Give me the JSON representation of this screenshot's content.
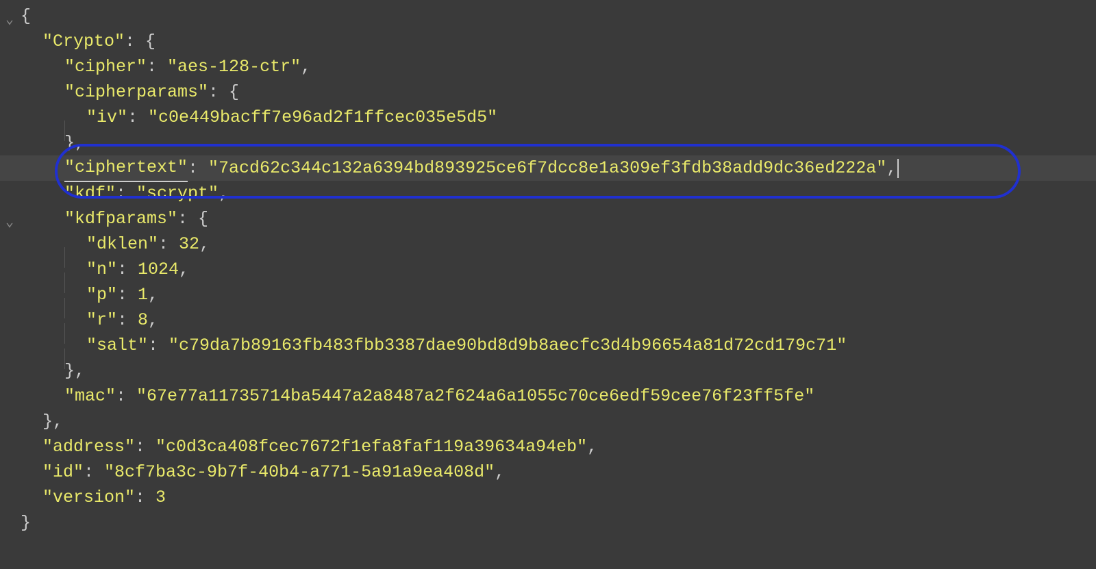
{
  "json_content": {
    "Crypto": {
      "cipher": "aes-128-ctr",
      "cipherparams": {
        "iv": "c0e449bacff7e96ad2f1ffcec035e5d5"
      },
      "ciphertext": "7acd62c344c132a6394bd893925ce6f7dcc8e1a309ef3fdb38add9dc36ed222a",
      "kdf": "scrypt",
      "kdfparams": {
        "dklen": 32,
        "n": 1024,
        "p": 1,
        "r": 8,
        "salt": "c79da7b89163fb483fbb3387dae90bd8d9b8aecfc3d4b96654a81d72cd179c71"
      },
      "mac": "67e77a11735714ba5447a2a8487a2f624a6a1055c70ce6edf59cee76f23ff5fe"
    },
    "address": "c0d3ca408fcec7672f1efa8faf119a39634a94eb",
    "id": "8cf7ba3c-9b7f-40b4-a771-5a91a9ea408d",
    "version": 3
  },
  "lines": [
    {
      "indent": 0,
      "tokens": [
        {
          "t": "punc",
          "v": "{"
        }
      ],
      "fold": true
    },
    {
      "indent": 1,
      "tokens": [
        {
          "t": "key",
          "v": "\"Crypto\""
        },
        {
          "t": "punc",
          "v": ": {"
        }
      ]
    },
    {
      "indent": 2,
      "tokens": [
        {
          "t": "key",
          "v": "\"cipher\""
        },
        {
          "t": "punc",
          "v": ": "
        },
        {
          "t": "str",
          "v": "\"aes-128-ctr\""
        },
        {
          "t": "punc",
          "v": ","
        }
      ]
    },
    {
      "indent": 2,
      "tokens": [
        {
          "t": "key",
          "v": "\"cipherparams\""
        },
        {
          "t": "punc",
          "v": ": {"
        }
      ]
    },
    {
      "indent": 3,
      "tokens": [
        {
          "t": "key",
          "v": "\"iv\""
        },
        {
          "t": "punc",
          "v": ": "
        },
        {
          "t": "str",
          "v": "\"c0e449bacff7e96ad2f1ffcec035e5d5\""
        }
      ],
      "guide": true
    },
    {
      "indent": 2,
      "tokens": [
        {
          "t": "punc",
          "v": "},"
        }
      ]
    },
    {
      "indent": 2,
      "tokens": [
        {
          "t": "key",
          "v": "\"ciphertext\""
        },
        {
          "t": "punc",
          "v": ": "
        },
        {
          "t": "str",
          "v": "\"7acd62c344c132a6394bd893925ce6f7dcc8e1a309ef3fdb38add9dc36ed222a\""
        },
        {
          "t": "punc",
          "v": ","
        }
      ],
      "highlighted": true,
      "cursor": true,
      "underline": true
    },
    {
      "indent": 2,
      "tokens": [
        {
          "t": "key",
          "v": "\"kdf\""
        },
        {
          "t": "punc",
          "v": ": "
        },
        {
          "t": "str",
          "v": "\"scrypt\""
        },
        {
          "t": "punc",
          "v": ","
        }
      ]
    },
    {
      "indent": 2,
      "tokens": [
        {
          "t": "key",
          "v": "\"kdfparams\""
        },
        {
          "t": "punc",
          "v": ": {"
        }
      ],
      "fold": true
    },
    {
      "indent": 3,
      "tokens": [
        {
          "t": "key",
          "v": "\"dklen\""
        },
        {
          "t": "punc",
          "v": ": "
        },
        {
          "t": "num",
          "v": "32"
        },
        {
          "t": "punc",
          "v": ","
        }
      ],
      "guide": true
    },
    {
      "indent": 3,
      "tokens": [
        {
          "t": "key",
          "v": "\"n\""
        },
        {
          "t": "punc",
          "v": ": "
        },
        {
          "t": "num",
          "v": "1024"
        },
        {
          "t": "punc",
          "v": ","
        }
      ],
      "guide": true
    },
    {
      "indent": 3,
      "tokens": [
        {
          "t": "key",
          "v": "\"p\""
        },
        {
          "t": "punc",
          "v": ": "
        },
        {
          "t": "num",
          "v": "1"
        },
        {
          "t": "punc",
          "v": ","
        }
      ],
      "guide": true
    },
    {
      "indent": 3,
      "tokens": [
        {
          "t": "key",
          "v": "\"r\""
        },
        {
          "t": "punc",
          "v": ": "
        },
        {
          "t": "num",
          "v": "8"
        },
        {
          "t": "punc",
          "v": ","
        }
      ],
      "guide": true
    },
    {
      "indent": 3,
      "tokens": [
        {
          "t": "key",
          "v": "\"salt\""
        },
        {
          "t": "punc",
          "v": ": "
        },
        {
          "t": "str",
          "v": "\"c79da7b89163fb483fbb3387dae90bd8d9b8aecfc3d4b96654a81d72cd179c71\""
        }
      ],
      "guide": true
    },
    {
      "indent": 2,
      "tokens": [
        {
          "t": "punc",
          "v": "},"
        }
      ]
    },
    {
      "indent": 2,
      "tokens": [
        {
          "t": "key",
          "v": "\"mac\""
        },
        {
          "t": "punc",
          "v": ": "
        },
        {
          "t": "str",
          "v": "\"67e77a11735714ba5447a2a8487a2f624a6a1055c70ce6edf59cee76f23ff5fe\""
        }
      ]
    },
    {
      "indent": 1,
      "tokens": [
        {
          "t": "punc",
          "v": "},"
        }
      ]
    },
    {
      "indent": 1,
      "tokens": [
        {
          "t": "key",
          "v": "\"address\""
        },
        {
          "t": "punc",
          "v": ": "
        },
        {
          "t": "str",
          "v": "\"c0d3ca408fcec7672f1efa8faf119a39634a94eb\""
        },
        {
          "t": "punc",
          "v": ","
        }
      ]
    },
    {
      "indent": 1,
      "tokens": [
        {
          "t": "key",
          "v": "\"id\""
        },
        {
          "t": "punc",
          "v": ": "
        },
        {
          "t": "str",
          "v": "\"8cf7ba3c-9b7f-40b4-a771-5a91a9ea408d\""
        },
        {
          "t": "punc",
          "v": ","
        }
      ]
    },
    {
      "indent": 1,
      "tokens": [
        {
          "t": "key",
          "v": "\"version\""
        },
        {
          "t": "punc",
          "v": ": "
        },
        {
          "t": "num",
          "v": "3"
        }
      ]
    },
    {
      "indent": 0,
      "tokens": [
        {
          "t": "punc",
          "v": "}"
        }
      ]
    }
  ],
  "annotation": {
    "target_key": "ciphertext",
    "color": "#2030d0"
  }
}
